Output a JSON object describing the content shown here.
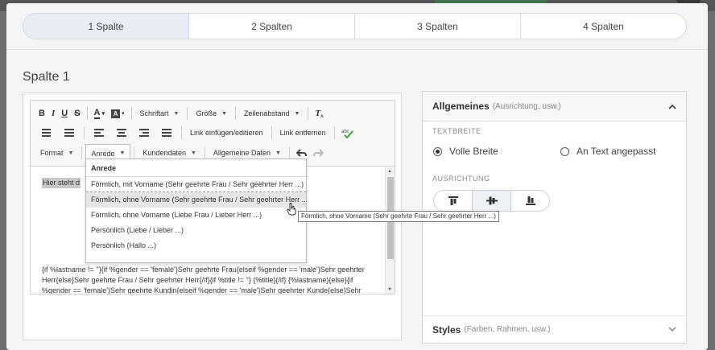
{
  "tabs": [
    {
      "label": "1 Spalte",
      "active": true
    },
    {
      "label": "2 Spalten",
      "active": false
    },
    {
      "label": "3 Spalten",
      "active": false
    },
    {
      "label": "4 Spalten",
      "active": false
    }
  ],
  "column_title": "Spalte 1",
  "toolbar": {
    "bold": "B",
    "italic": "I",
    "underline": "U",
    "strike": "S",
    "text_color": "A",
    "font_combo": "Schriftart",
    "size_combo": "Größe",
    "line_height_combo": "Zeilenabstand",
    "remove_format": "T",
    "link_edit": "Link einfügen/editieren",
    "link_remove": "Link entfernen",
    "format_combo": "Format",
    "salutation_combo": "Anrede",
    "customer_data_combo": "Kundendaten",
    "general_data_combo": "Allgemeine Daten"
  },
  "editor": {
    "placeholder_text": "Hier steht d",
    "merge_code": "{if %lastname != ''}{if %gender == 'female'}Sehr geehrte Frau{elseif %gender == 'male'}Sehr geehrter Herr{else}Sehr geehrte Frau / Sehr geehrter Herr{/if}{if %title != ''} {%title}{/if} {%lastname}{else}{if %gender == 'female'}Sehr geehrte Kundin{elseif %gender == 'male'}Sehr geehrter Kunde{else}Sehr geehrte Kundin / Sehr geehrter Kunde{/if}{/if}"
  },
  "dropdown": {
    "title": "Anrede",
    "items": [
      "Förmlich, mit Vorname (Sehr geehrte Frau / Sehr geehrter Herr ...)",
      "Förmlich, ohne Vorname (Sehr geehrte Frau / Sehr geehrter Herr ...)",
      "Förmlich, ohne Vorname (Liebe Frau / Lieber Herr ...)",
      "Persönlich (Liebe / Lieber ...)",
      "Persönlich (Hallo ...)"
    ],
    "tooltip": "Förmlich, ohne Vorname (Sehr geehrte Frau / Sehr geehrter Herr ...)"
  },
  "panel": {
    "title": "Allgemeines",
    "subtitle": "(Ausrichtung, usw.)",
    "text_width_label": "TEXTBREITE",
    "full_width": "Volle Breite",
    "fit_text": "An Text angepasst",
    "alignment_label": "AUSRICHTUNG",
    "styles_title": "Styles",
    "styles_subtitle": "(Farben, Rahmen, usw.)"
  },
  "colors": {
    "accent_green": "#3d9a3d",
    "active_tab": "#e9eef6",
    "overlay": "#6e6e6e"
  }
}
